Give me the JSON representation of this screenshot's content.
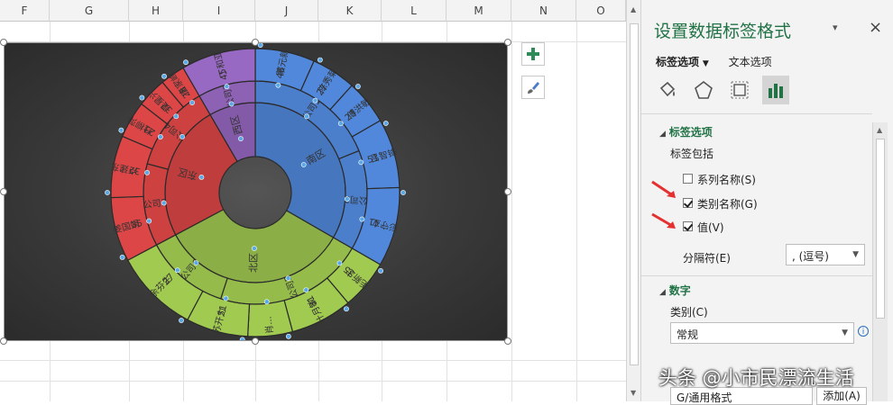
{
  "sheet": {
    "columns": [
      "F",
      "G",
      "H",
      "I",
      "J",
      "K",
      "L",
      "M",
      "N",
      "O"
    ]
  },
  "chart_data": {
    "type": "sunburst",
    "title": "",
    "rings": {
      "inner": [
        {
          "name": "南区",
          "color": "#4a7cc7"
        },
        {
          "name": "北区",
          "color": "#92b84a"
        },
        {
          "name": "东区",
          "color": "#c94040"
        },
        {
          "name": "西区",
          "color": "#8a5fb0"
        }
      ],
      "middle": [
        {
          "name": "公司1",
          "region": "南区"
        },
        {
          "name": "公司2",
          "region": "南区"
        },
        {
          "name": "公司5",
          "region": "北区"
        },
        {
          "name": "公司6",
          "region": "北区"
        },
        {
          "name": "公司3",
          "region": "东区"
        },
        {
          "name": "公司4",
          "region": "东区"
        },
        {
          "name": "公司7",
          "region": "西区"
        }
      ],
      "outer": [
        {
          "name": "蔡元新",
          "value": 46
        },
        {
          "name": "陈秀菊",
          "value": 27
        },
        {
          "name": "傅洪敏",
          "value": 23
        },
        {
          "name": "吕智锋",
          "value": 51
        },
        {
          "name": "彭守立",
          "value": 41
        },
        {
          "name": "毛新忠",
          "value": 35
        },
        {
          "name": "叶月敏",
          "value": 31
        },
        {
          "name": "肖...",
          "value": null
        },
        {
          "name": "苏开力",
          "value": 51
        },
        {
          "name": "余芬生",
          "value": 27
        },
        {
          "name": "姜国娟",
          "value": 35
        },
        {
          "name": "卢建东",
          "value": 32
        },
        {
          "name": "杜柳萍",
          "value": 23
        },
        {
          "name": "吴星兴",
          "value": 32
        },
        {
          "name": "唐家峰",
          "value": 28
        },
        {
          "name": "丁和亚",
          "value": 45
        }
      ]
    }
  },
  "pane": {
    "title": "设置数据标签格式",
    "close": "×",
    "dropdown": "▾",
    "tab_label": "标签选项",
    "tab_text": "文本选项",
    "sec_label": "标签选项",
    "label_contains": "标签包括",
    "cb_series": "系列名称(S)",
    "cb_category": "类别名称(G)",
    "cb_value": "值(V)",
    "separator_label": "分隔符(E)",
    "separator_value": ", (逗号)",
    "sec_number": "数字",
    "category_label": "类别(C)",
    "category_value": "常规",
    "format_code": "G/通用格式",
    "add_button": "添加(A)"
  },
  "watermark": "头条 @小市民漂流生活",
  "colors": {
    "excel_green": "#217346",
    "south": "#4a7cc7",
    "north": "#92b84a",
    "east": "#c94040",
    "west": "#8a5fb0",
    "arrow_red": "#e53030"
  }
}
